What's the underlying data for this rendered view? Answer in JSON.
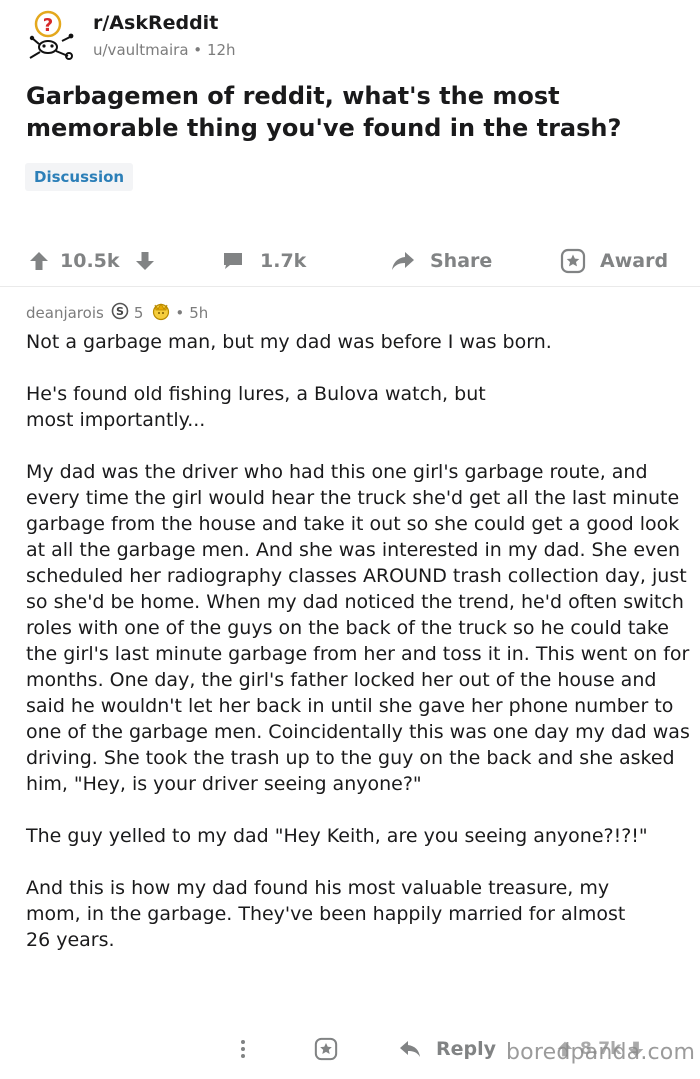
{
  "post": {
    "subreddit": "r/AskReddit",
    "author": "u/vaultmaira",
    "separator": "•",
    "age": "12h",
    "title": "Garbagemen of reddit, what's the most memorable thing you've found in the trash?",
    "flair": "Discussion",
    "upvotes": "10.5k",
    "comments": "1.7k",
    "share_label": "Share",
    "award_label": "Award"
  },
  "comment": {
    "author": "deanjarois",
    "badge_count": "5",
    "separator": "•",
    "age": "5h",
    "paragraphs": [
      "Not a garbage man, but my dad was before I was born.",
      "He's found old fishing lures, a Bulova watch, but most importantly...",
      "My dad was the driver who had this one girl's garbage route, and every time the girl would hear the truck she'd get all the last minute garbage from the house and take it out so she could get a good look at all the garbage men. And she was interested in my dad. She even scheduled her radiography classes AROUND trash collection day, just so she'd be home. When my dad noticed the trend, he'd often switch roles with one of the guys on the back of the truck so he could take the girl's last minute garbage from her and toss it in. This went on for months. One day, the girl's father locked her out of the house and said he wouldn't let her back in until she gave her phone number to one of the garbage men. Coincidentally this was one day my dad was driving. She took the trash up to the guy on the back and she asked him, \"Hey, is your driver seeing anyone?\"",
      "The guy yelled to my dad \"Hey Keith, are you seeing anyone?!?!\"",
      "And this is how my dad found his most valuable treasure, my mom, in the garbage. They've been happily married for almost 26 years."
    ],
    "reply_label": "Reply",
    "score": "8.7k"
  },
  "watermark": "boredpanda.com",
  "icons": {
    "subreddit": "askreddit-snoo-icon",
    "upvote": "upvote-arrow-icon",
    "downvote": "downvote-arrow-icon",
    "comments": "comment-bubble-icon",
    "share": "share-arrow-icon",
    "award": "award-star-icon",
    "badge_silver": "silver-s-badge-icon",
    "badge_gold": "gold-crown-badge-icon",
    "more": "more-vertical-dots-icon",
    "reply": "reply-arrow-icon"
  },
  "colors": {
    "text": "#1a1a1b",
    "meta": "#7c7c7c",
    "action": "#818384",
    "flair_text": "#2c7fb8",
    "flair_bg": "#f3f4f6",
    "snoo_ring": "#e4a81d",
    "snoo_q": "#d62828"
  }
}
